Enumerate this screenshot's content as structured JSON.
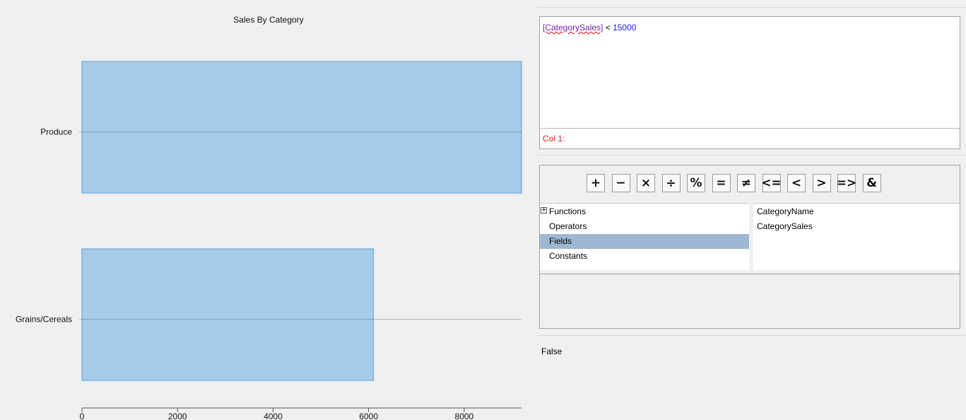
{
  "chart_data": {
    "type": "bar",
    "orientation": "horizontal",
    "title": "Sales By Category",
    "categories": [
      "Produce",
      "Grains/Cereals"
    ],
    "values": [
      9200,
      6100
    ],
    "xlim": [
      0,
      9200
    ],
    "x_ticks": [
      0,
      2000,
      4000,
      6000,
      8000
    ],
    "x_tick_labels": [
      "0",
      "2000",
      "4000",
      "6000",
      "8000"
    ],
    "bar_color": "#a6cbea",
    "bar_edge_color": "#7fb2de"
  },
  "expression": {
    "field_token": "[CategorySales]",
    "operator": " < ",
    "value": "15000",
    "status": "Col 1:"
  },
  "operators": [
    {
      "symbol": "+",
      "name": "plus"
    },
    {
      "symbol": "−",
      "name": "minus"
    },
    {
      "symbol": "×",
      "name": "multiply"
    },
    {
      "symbol": "÷",
      "name": "divide"
    },
    {
      "symbol": "%",
      "name": "modulo"
    },
    {
      "symbol": "=",
      "name": "equals"
    },
    {
      "symbol": "≠",
      "name": "not-equal"
    },
    {
      "symbol": "<=",
      "name": "less-equal"
    },
    {
      "symbol": "<",
      "name": "less-than"
    },
    {
      "symbol": ">",
      "name": "greater-than"
    },
    {
      "symbol": "=>",
      "name": "greater-equal"
    },
    {
      "symbol": "&",
      "name": "ampersand"
    }
  ],
  "categories_tree": [
    {
      "label": "Functions",
      "expandable": true,
      "selected": false
    },
    {
      "label": "Operators",
      "expandable": false,
      "selected": false
    },
    {
      "label": "Fields",
      "expandable": false,
      "selected": true
    },
    {
      "label": "Constants",
      "expandable": false,
      "selected": false
    }
  ],
  "fields": [
    "CategoryName",
    "CategorySales"
  ],
  "result": "False"
}
